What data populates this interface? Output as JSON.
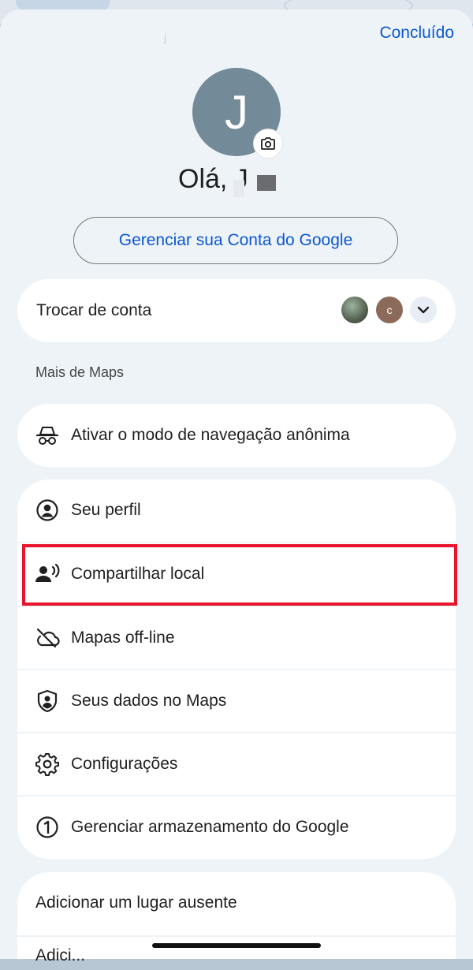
{
  "header": {
    "done_label": "Concluído",
    "faint_name": "j"
  },
  "profile": {
    "avatar_initial": "J",
    "greeting": "Olá, J"
  },
  "manage_account_label": "Gerenciar sua Conta do Google",
  "switch_account": {
    "label": "Trocar de conta",
    "second_account_initial": "c"
  },
  "section_title": "Mais de Maps",
  "incognito_label": "Ativar o modo de navegação anônima",
  "menu": [
    {
      "label": "Seu perfil",
      "icon": "account-circle-icon"
    },
    {
      "label": "Compartilhar local",
      "icon": "share-location-icon"
    },
    {
      "label": "Mapas off-line",
      "icon": "cloud-off-icon"
    },
    {
      "label": "Seus dados no Maps",
      "icon": "shield-person-icon"
    },
    {
      "label": "Configurações",
      "icon": "gear-icon"
    },
    {
      "label": "Gerenciar armazenamento do Google",
      "icon": "storage-one-icon"
    }
  ],
  "bottom": {
    "add_place_label": "Adicionar um lugar ausente",
    "next_label_partial": "Adici..."
  },
  "colors": {
    "accent": "#0b57d0",
    "highlight": "#e8142c",
    "sheet": "#eef3f8"
  }
}
